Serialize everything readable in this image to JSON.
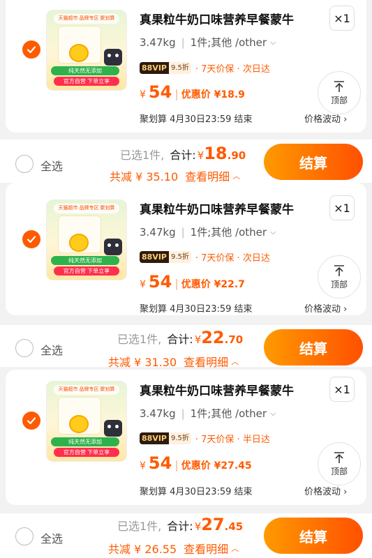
{
  "colors": {
    "accent": "#ff5a00",
    "background": "#f2f2f2"
  },
  "items": [
    {
      "title": "真果粒牛奶口味营养早餐蒙牛",
      "qty": "×1",
      "weight": "3.47kg",
      "spec": "1件;其他 /other",
      "vip_a": "88VIP",
      "vip_b": "9.5折",
      "ship": "· 7天价保 · 次日达",
      "price_symbol": "¥",
      "price": "54",
      "discount": "优惠价 ¥18.9",
      "ju": "聚划算 4月30日23:59 结束",
      "wave": "价格波动 ›",
      "top_label": "顶部",
      "thumb_top": "天猫超市 品牌专区 聚划算",
      "thumb_green": "纯天然无添加",
      "thumb_red": "官方自营 下单立享",
      "footer": {
        "select_all": "全选",
        "selected": "已选1件,",
        "total_label": "合计:",
        "yen": "¥",
        "total_big": "18",
        "total_small": ".90",
        "saved": "共减 ¥ 35.10",
        "detail": "查看明细",
        "pay": "结算"
      }
    },
    {
      "title": "真果粒牛奶口味营养早餐蒙牛",
      "qty": "×1",
      "weight": "3.47kg",
      "spec": "1件;其他 /other",
      "vip_a": "88VIP",
      "vip_b": "9.5折",
      "ship": "· 7天价保 · 次日达",
      "price_symbol": "¥",
      "price": "54",
      "discount": "优惠价 ¥22.7",
      "ju": "聚划算 4月30日23:59 结束",
      "wave": "价格波动 ›",
      "top_label": "顶部",
      "thumb_top": "天猫超市 品牌专区 聚划算",
      "thumb_green": "纯天然无添加",
      "thumb_red": "官方自营 下单立享",
      "footer": {
        "select_all": "全选",
        "selected": "已选1件,",
        "total_label": "合计:",
        "yen": "¥",
        "total_big": "22",
        "total_small": ".70",
        "saved": "共减 ¥ 31.30",
        "detail": "查看明细",
        "pay": "结算"
      }
    },
    {
      "title": "真果粒牛奶口味营养早餐蒙牛",
      "qty": "×1",
      "weight": "3.47kg",
      "spec": "1件;其他 /other",
      "vip_a": "88VIP",
      "vip_b": "9.5折",
      "ship": "· 7天价保 · 半日达",
      "price_symbol": "¥",
      "price": "54",
      "discount": "优惠价 ¥27.45",
      "ju": "聚划算 4月30日23:59 结束",
      "wave": "价格波动 ›",
      "top_label": "顶部",
      "thumb_top": "天猫超市 品牌专区 聚划算",
      "thumb_green": "纯天然无添加",
      "thumb_red": "官方自营 下单立享",
      "footer": {
        "select_all": "全选",
        "selected": "已选1件,",
        "total_label": "合计:",
        "yen": "¥",
        "total_big": "27",
        "total_small": ".45",
        "saved": "共减 ¥ 26.55",
        "detail": "查看明细",
        "pay": "结算"
      }
    }
  ]
}
